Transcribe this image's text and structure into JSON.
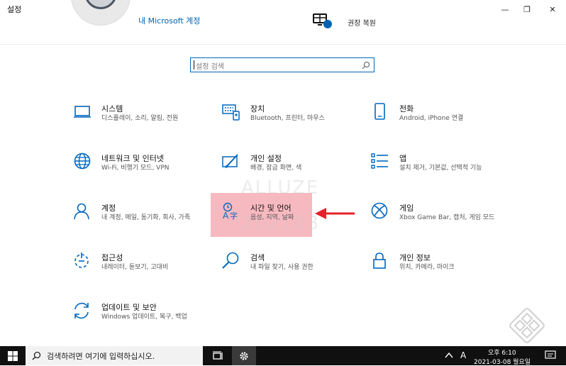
{
  "window": {
    "title": "설정",
    "minimize_symbol": "—",
    "maximize_symbol": "❐",
    "close_symbol": "✕"
  },
  "header": {
    "ms_account_link": "내 Microsoft 계정",
    "recommended_label": "권장 복원"
  },
  "search": {
    "placeholder": "설정 검색"
  },
  "tiles": [
    {
      "icon": "laptop-icon",
      "title": "시스템",
      "desc": "디스플레이, 소리, 알림, 전원"
    },
    {
      "icon": "keyboard-device-icon",
      "title": "장치",
      "desc": "Bluetooth, 프린터, 마우스"
    },
    {
      "icon": "phone-icon",
      "title": "전화",
      "desc": "Android, iPhone 연결"
    },
    {
      "icon": "globe-icon",
      "title": "네트워크 및 인터넷",
      "desc": "Wi-Fi, 비행기 모드, VPN"
    },
    {
      "icon": "personalization-brush-icon",
      "title": "개인 설정",
      "desc": "배경, 잠금 화면, 색"
    },
    {
      "icon": "apps-list-icon",
      "title": "앱",
      "desc": "설치 제거, 기본값, 선택적 기능"
    },
    {
      "icon": "person-icon",
      "title": "계정",
      "desc": "내 계정, 메일, 동기화, 회사, 가족"
    },
    {
      "icon": "time-language-icon",
      "title": "시간 및 언어",
      "desc": "음성, 지역, 날짜"
    },
    {
      "icon": "xbox-icon",
      "title": "게임",
      "desc": "Xbox Game Bar, 캡처, 게임 모드"
    },
    {
      "icon": "ease-of-access-icon",
      "title": "접근성",
      "desc": "내레이터, 돋보기, 고대비"
    },
    {
      "icon": "search-magnifier-icon",
      "title": "검색",
      "desc": "내 파일 찾기, 사용 권한"
    },
    {
      "icon": "lock-icon",
      "title": "개인 정보",
      "desc": "위치, 카메라, 마이크"
    },
    {
      "icon": "update-sync-icon",
      "title": "업데이트 및 보안",
      "desc": "Windows 업데이트, 복구, 백업"
    }
  ],
  "watermark": {
    "line1": "ALLUZE",
    "line2": "202103"
  },
  "taskbar": {
    "search_text": "검색하려면 여기에 입력하십시오.",
    "ime_label": "A",
    "time": "오후 6:10",
    "date": "2021-03-08 월요일"
  },
  "colors": {
    "accent": "#0067c0",
    "highlight": "#f0808c",
    "arrow": "#e8202a",
    "taskbar": "#101010"
  }
}
